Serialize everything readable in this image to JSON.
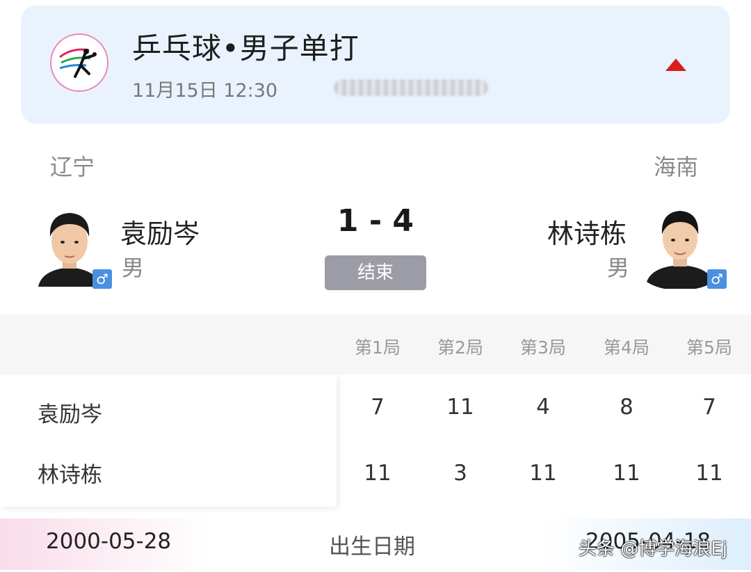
{
  "header": {
    "title": "乒乓球•男子单打",
    "time": "11月15日 12:30",
    "logo_icon": "table-tennis-icon",
    "toggle_icon": "collapse-up-icon",
    "accent": "#d81e1e"
  },
  "match": {
    "left": {
      "team": "辽宁",
      "name": "袁励岑",
      "gender": "男"
    },
    "right": {
      "team": "海南",
      "name": "林诗栋",
      "gender": "男"
    },
    "score": "1 - 4",
    "status": "结束",
    "gender_icon": "male-icon"
  },
  "sets": {
    "headers": [
      "第1局",
      "第2局",
      "第3局",
      "第4局",
      "第5局"
    ],
    "rows": [
      {
        "player": "袁励岑",
        "scores": [
          "7",
          "11",
          "4",
          "8",
          "7"
        ]
      },
      {
        "player": "林诗栋",
        "scores": [
          "11",
          "3",
          "11",
          "11",
          "11"
        ]
      }
    ]
  },
  "info": {
    "label": "出生日期",
    "left": "2000-05-28",
    "right": "2005-04-18"
  },
  "watermark": "头条 @博学海浪Ej"
}
